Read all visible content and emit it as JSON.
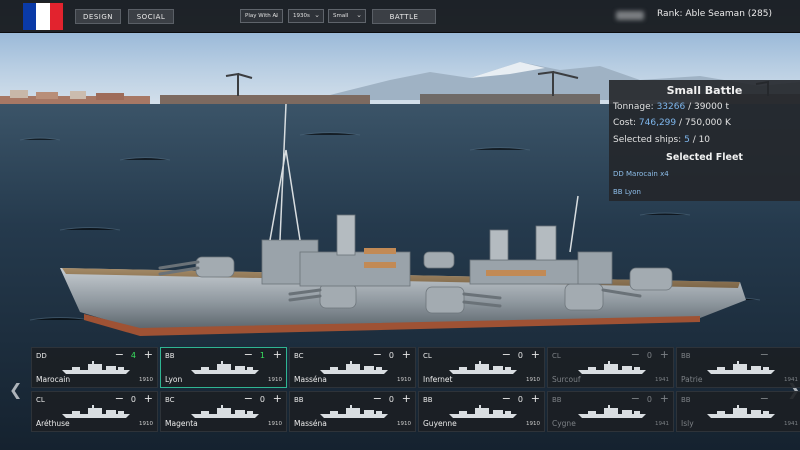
{
  "colors": {
    "flag_blue": "#0a3aa7",
    "flag_white": "#ffffff",
    "flag_red": "#e2232e",
    "accent_green": "#38e05f",
    "selected_border": "#2fb592",
    "highlight_blue": "#7eb6ec"
  },
  "topbar": {
    "design_label": "DESIGN",
    "social_label": "SOCIAL",
    "opponent_select": "Play With AI",
    "era_select": "1930s",
    "size_select": "Small",
    "battle_label": "BATTLE",
    "rank": "Rank: Able Seaman (285)"
  },
  "panel": {
    "title": "Small Battle",
    "tonnage_label": "Tonnage:",
    "tonnage_value": "33266",
    "tonnage_max": "/ 39000 t",
    "cost_label": "Cost:",
    "cost_value": "746,299",
    "cost_max": "/ 750,000 K",
    "ships_label": "Selected ships:",
    "ships_value": "5",
    "ships_max": "/ 10",
    "fleet_title": "Selected Fleet",
    "fleet": [
      "DD Marocain x4",
      "BB Lyon"
    ]
  },
  "icons": {
    "prev": "chevron-left-icon",
    "next": "chevron-right-icon",
    "minus": "minus-icon",
    "plus": "plus-icon"
  },
  "cards": [
    {
      "cls": "DD",
      "count": "4",
      "name": "Marocain",
      "year": "1910",
      "highlight": true,
      "active": false,
      "dim": false,
      "show_count": true
    },
    {
      "cls": "BB",
      "count": "1",
      "name": "Lyon",
      "year": "1910",
      "highlight": true,
      "active": true,
      "dim": false,
      "show_count": true
    },
    {
      "cls": "BC",
      "count": "0",
      "name": "Masséna",
      "year": "1910",
      "highlight": false,
      "active": false,
      "dim": false,
      "show_count": true
    },
    {
      "cls": "CL",
      "count": "0",
      "name": "Infernet",
      "year": "1910",
      "highlight": false,
      "active": false,
      "dim": false,
      "show_count": true
    },
    {
      "cls": "CL",
      "count": "0",
      "name": "Surcouf",
      "year": "1941",
      "highlight": false,
      "active": false,
      "dim": true,
      "show_count": true
    },
    {
      "cls": "BB",
      "count": "",
      "name": "Patrie",
      "year": "1941",
      "highlight": false,
      "active": false,
      "dim": true,
      "show_count": false
    },
    {
      "cls": "CL",
      "count": "0",
      "name": "Aréthuse",
      "year": "1910",
      "highlight": false,
      "active": false,
      "dim": false,
      "show_count": true
    },
    {
      "cls": "BC",
      "count": "0",
      "name": "Magenta",
      "year": "1910",
      "highlight": false,
      "active": false,
      "dim": false,
      "show_count": true
    },
    {
      "cls": "BB",
      "count": "0",
      "name": "Masséna",
      "year": "1910",
      "highlight": false,
      "active": false,
      "dim": false,
      "show_count": true
    },
    {
      "cls": "BB",
      "count": "0",
      "name": "Guyenne",
      "year": "1910",
      "highlight": false,
      "active": false,
      "dim": false,
      "show_count": true
    },
    {
      "cls": "BB",
      "count": "0",
      "name": "Cygne",
      "year": "1941",
      "highlight": false,
      "active": false,
      "dim": true,
      "show_count": true
    },
    {
      "cls": "BB",
      "count": "",
      "name": "Isly",
      "year": "1941",
      "highlight": false,
      "active": false,
      "dim": true,
      "show_count": false
    }
  ]
}
